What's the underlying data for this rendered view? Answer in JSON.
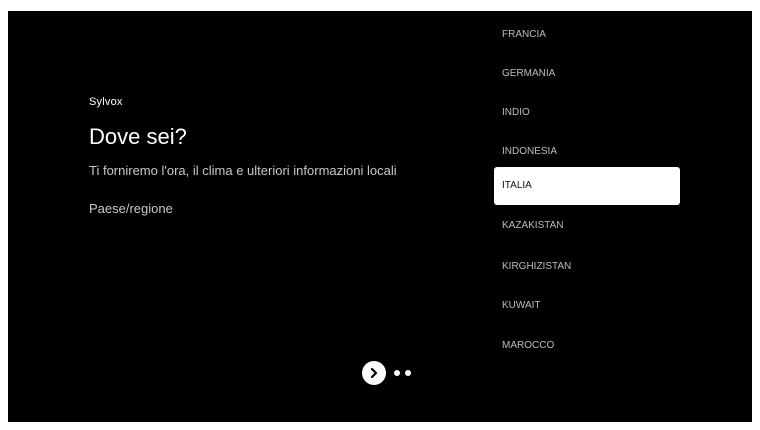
{
  "brand": "Sylvox",
  "title": "Dove sei?",
  "subtitle": "Ti forniremo l'ora, il clima e ulteriori informazioni locali",
  "field_label": "Paese/regione",
  "countries": [
    {
      "label": "FRANCIA",
      "selected": false
    },
    {
      "label": "GERMANIA",
      "selected": false
    },
    {
      "label": "INDIO",
      "selected": false
    },
    {
      "label": "INDONESIA",
      "selected": false
    },
    {
      "label": "ITALIA",
      "selected": true
    },
    {
      "label": "KAZAKISTAN",
      "selected": false
    },
    {
      "label": "KIRGHIZISTAN",
      "selected": false
    },
    {
      "label": "KUWAIT",
      "selected": false
    },
    {
      "label": "MAROCCO",
      "selected": false
    }
  ],
  "pager": {
    "next_icon": "chevron-right-icon",
    "total_steps": 3,
    "current_step": 1
  },
  "colors": {
    "background": "#000000",
    "selected_item": "#ffffff",
    "text_primary": "#ffffff",
    "text_secondary": "#c8c8c8"
  }
}
